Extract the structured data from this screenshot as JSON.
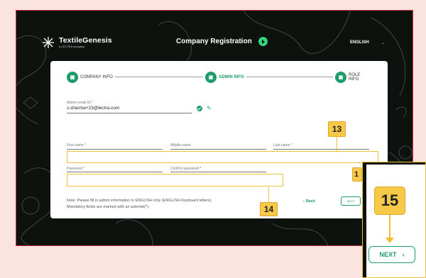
{
  "header": {
    "brand_name": "TextileGenesis",
    "brand_sub": "a LECTRA company",
    "app_title": "Company Registration",
    "language": "ENGLISH"
  },
  "steps": [
    {
      "label": "COMPANY INFO",
      "active": false
    },
    {
      "label": "ADMIN INFO",
      "active": true
    },
    {
      "label": "ROLE INFO",
      "active": false
    }
  ],
  "form": {
    "admin_email_label": "Admin email ID *",
    "admin_email_value": "s.sharma+23@lectra.com",
    "first_name_label": "First name *",
    "middle_name_label": "Middle name",
    "last_name_label": "Last name *",
    "password_label": "Password *",
    "confirm_password_label": "Confirm password *"
  },
  "note": {
    "line1": "Note: Please fill in admin information in ENGLISH only (ENGLISH Keyboard letters).",
    "line2": "Mandatory fields are marked with an asterisk(*)."
  },
  "buttons": {
    "back": "Back",
    "next": "NEXT"
  },
  "callouts": {
    "c13": "13",
    "c14": "14",
    "c15_partial": "1",
    "c15": "15"
  },
  "colors": {
    "accent": "#1e9c6c",
    "highlight": "#f0bf34",
    "background": "#0d120f",
    "page": "#fbe3e1"
  }
}
